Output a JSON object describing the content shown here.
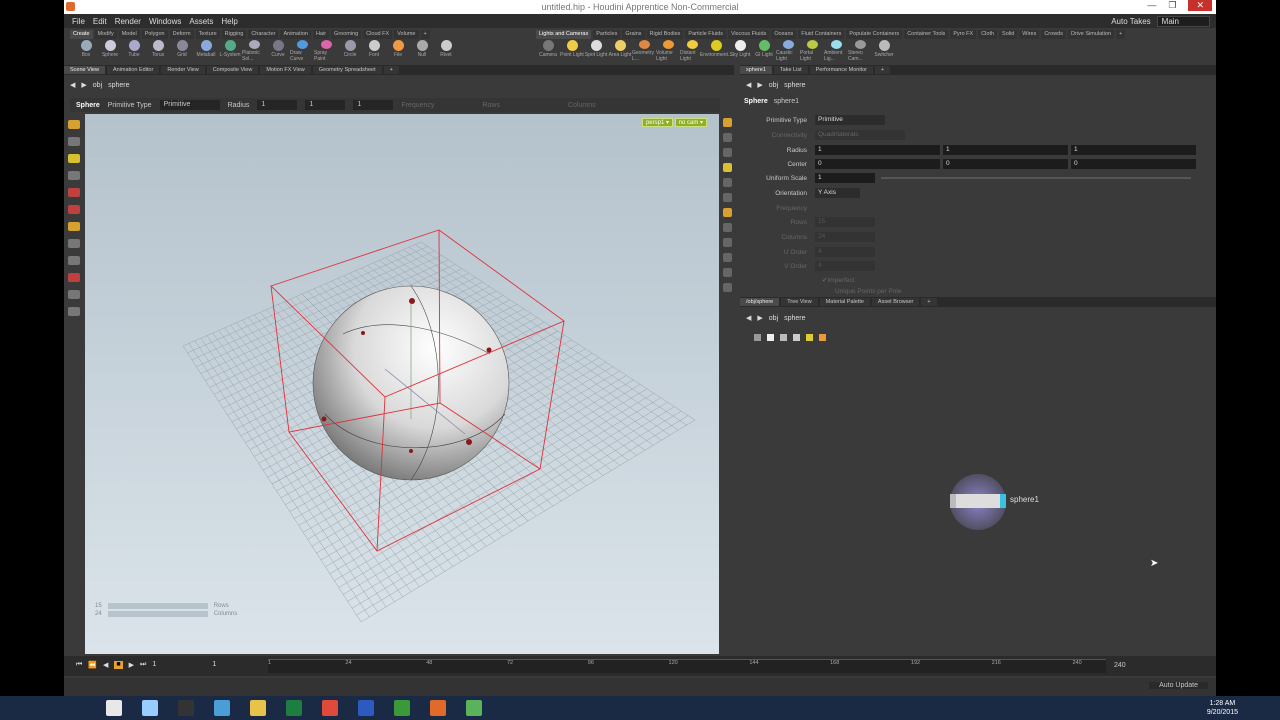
{
  "window": {
    "title": "untitled.hip - Houdini Apprentice Non-Commercial",
    "min": "—",
    "max": "❐",
    "close": "✕"
  },
  "menu": [
    "File",
    "Edit",
    "Render",
    "Windows",
    "Assets",
    "Help"
  ],
  "menu_right": {
    "auto_takes": "Auto Takes",
    "desktop": "Main"
  },
  "shelf_tabs_left": [
    "Create",
    "Modify",
    "Model",
    "Polygon",
    "Deform",
    "Texture",
    "Rigging",
    "Character",
    "Animation",
    "Hair",
    "Grooming",
    "Cloud FX",
    "Volume",
    "+"
  ],
  "shelf_tabs_right": [
    "Lights and Cameras",
    "Particles",
    "Grains",
    "Rigid Bodies",
    "Particle Fluids",
    "Viscous Fluids",
    "Oceans",
    "Fluid Containers",
    "Populate Containers",
    "Container Tools",
    "Pyro FX",
    "Cloth",
    "Solid",
    "Wires",
    "Crowds",
    "Drive Simulation",
    "+"
  ],
  "tools_left": [
    {
      "label": "Box",
      "color": "#9ab"
    },
    {
      "label": "Sphere",
      "color": "#ccd"
    },
    {
      "label": "Tube",
      "color": "#aac"
    },
    {
      "label": "Torus",
      "color": "#bbc"
    },
    {
      "label": "Grid",
      "color": "#889"
    },
    {
      "label": "Metaball",
      "color": "#8ad"
    },
    {
      "label": "L-System",
      "color": "#5a8"
    },
    {
      "label": "Platonic Sol...",
      "color": "#aab"
    },
    {
      "label": "Curve",
      "color": "#778"
    },
    {
      "label": "Draw Curve",
      "color": "#59d"
    },
    {
      "label": "Spray Paint",
      "color": "#d6a"
    },
    {
      "label": "Circle",
      "color": "#99a"
    },
    {
      "label": "Font",
      "color": "#ccc"
    },
    {
      "label": "File",
      "color": "#e94"
    },
    {
      "label": "Null",
      "color": "#aaa"
    },
    {
      "label": "Rivet",
      "color": "#ccc"
    }
  ],
  "tools_right": [
    {
      "label": "Camera",
      "color": "#777"
    },
    {
      "label": "Point Light",
      "color": "#ec4"
    },
    {
      "label": "Spot Light",
      "color": "#ddd"
    },
    {
      "label": "Area Light",
      "color": "#ec6"
    },
    {
      "label": "Geometry L...",
      "color": "#d84"
    },
    {
      "label": "Volume Light",
      "color": "#e93"
    },
    {
      "label": "Distant Light",
      "color": "#ec4"
    },
    {
      "label": "Environment...",
      "color": "#dc2"
    },
    {
      "label": "Sky Light",
      "color": "#eee"
    },
    {
      "label": "GI Light",
      "color": "#6b6"
    },
    {
      "label": "Caustic Light",
      "color": "#8ad"
    },
    {
      "label": "Portal Light",
      "color": "#bc4"
    },
    {
      "label": "Ambient Lig...",
      "color": "#9de"
    },
    {
      "label": "Stereo Cam...",
      "color": "#999"
    },
    {
      "label": "Switcher",
      "color": "#bbb"
    }
  ],
  "left_tabs": [
    "Scene View",
    "Animation Editor",
    "Render View",
    "Composite View",
    "Motion FX View",
    "Geometry Spreadsheet",
    "+"
  ],
  "right_top_tabs": [
    "sphere1",
    "Take List",
    "Performance Monitor",
    "+"
  ],
  "right_bottom_tabs": [
    "/obj/sphere",
    "Tree View",
    "Material Palette",
    "Asset Browser",
    "+"
  ],
  "path": {
    "root": "obj",
    "node": "sphere"
  },
  "viewport_ops": {
    "node_label": "Sphere",
    "prim_type_label": "Primitive Type",
    "prim_type": "Primitive",
    "radius_label": "Radius",
    "r1": "1",
    "r2": "1",
    "r3": "1",
    "freq_label": "Frequency",
    "rows_label": "Rows",
    "cols_label": "Columns"
  },
  "viewport": {
    "cam_badge_1": "persp1 ▾",
    "cam_badge_2": "no cam ▾",
    "hud_rows": "Rows",
    "hud_cols": "Columns",
    "hud_val_1": "15",
    "hud_val_2": "24"
  },
  "params": {
    "node_type": "Sphere",
    "node_name": "sphere1",
    "primitive_type_label": "Primitive Type",
    "primitive_type": "Primitive",
    "connectivity_label": "Connectivity",
    "connectivity": "Quadrilaterals",
    "radius_label": "Radius",
    "radius": [
      "1",
      "1",
      "1"
    ],
    "center_label": "Center",
    "center": [
      "0",
      "0",
      "0"
    ],
    "uniform_scale_label": "Uniform Scale",
    "uniform_scale": "1",
    "orientation_label": "Orientation",
    "orientation": "Y Axis",
    "frequency_label": "Frequency",
    "rows_label": "Rows",
    "rows": "15",
    "columns_label": "Columns",
    "columns": "24",
    "uorder_label": "U Order",
    "uorder": "4",
    "vorder_label": "V Order",
    "vorder": "4",
    "imperfect": "Imperfect",
    "unique_points": "Unique Points per Pole"
  },
  "network": {
    "node_label": "sphere1"
  },
  "timeline": {
    "frame": "1",
    "start": "1",
    "end": "240",
    "ticks": [
      "1",
      "24",
      "48",
      "72",
      "96",
      "120",
      "144",
      "168",
      "192",
      "216",
      "240"
    ],
    "end_field": "240"
  },
  "status": {
    "auto_update": "Auto Update"
  },
  "taskbar": {
    "time": "1:28 AM",
    "date": "9/20/2015"
  },
  "taskbar_icons": [
    {
      "name": "windows-start-icon",
      "color": "#1b2a44"
    },
    {
      "name": "file-icon",
      "color": "#e8e8e8"
    },
    {
      "name": "document-icon",
      "color": "#9cf"
    },
    {
      "name": "vnc-icon",
      "color": "#333"
    },
    {
      "name": "monitor-icon",
      "color": "#4a9ed8"
    },
    {
      "name": "explorer-folder-icon",
      "color": "#e8c34a"
    },
    {
      "name": "excel-icon",
      "color": "#1d7f3f"
    },
    {
      "name": "chrome-icon",
      "color": "#e04a3a"
    },
    {
      "name": "lync-icon",
      "color": "#2b5bbf"
    },
    {
      "name": "camtasia-icon",
      "color": "#3a9a3a"
    },
    {
      "name": "houdini-icon",
      "color": "#e06a2a"
    },
    {
      "name": "camtasia-recorder-icon",
      "color": "#5ab35a"
    }
  ]
}
